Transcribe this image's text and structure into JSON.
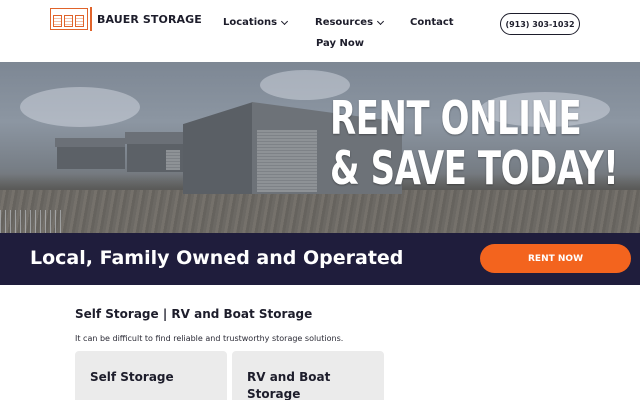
{
  "header": {
    "logo_text": "BAUER STORAGE",
    "nav": {
      "locations": "Locations",
      "resources": "Resources",
      "contact": "Contact",
      "pay_now": "Pay Now"
    },
    "phone": "(913) 303-1032"
  },
  "hero": {
    "line1": "RENT ONLINE",
    "line2": "& SAVE TODAY!"
  },
  "banner": {
    "text": "Local, Family Owned and Operated",
    "cta": "RENT NOW"
  },
  "content": {
    "title": "Self Storage | RV and Boat Storage",
    "description": "It can be difficult to find reliable and trustworthy storage solutions.",
    "cards": [
      {
        "title": "Self Storage"
      },
      {
        "title": "RV and Boat Storage"
      }
    ]
  },
  "colors": {
    "accent": "#f3641e",
    "banner_bg": "#1f1d3c",
    "logo_orange": "#e0632a",
    "text_dark": "#1d1d2b",
    "card_bg": "#ebebeb"
  },
  "icons": {
    "dropdown": "chevron-down-icon",
    "logo": "storage-units-logo-icon"
  }
}
